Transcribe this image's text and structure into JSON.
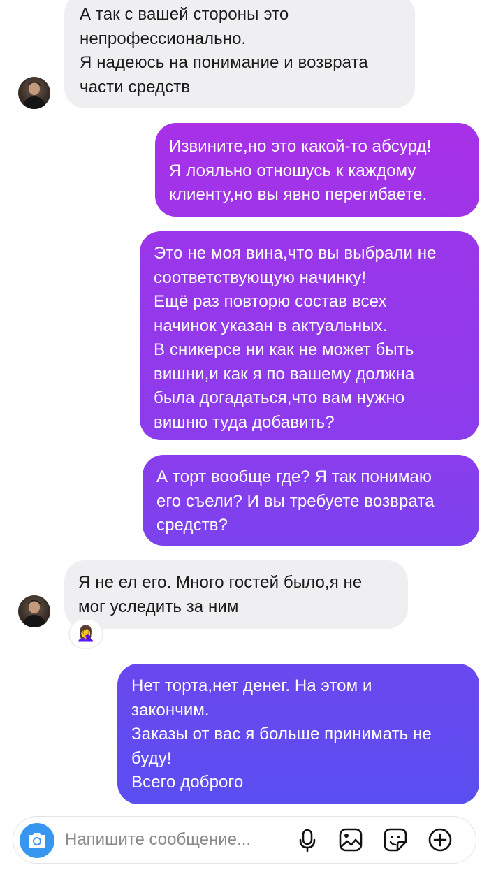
{
  "messages": [
    {
      "side": "incoming",
      "lines": [
        "А так с вашей стороны это",
        "непрофессионально.",
        "Я надеюсь на понимание и возврата",
        "части средств"
      ]
    },
    {
      "side": "outgoing",
      "lines": [
        "Извините,но это какой-то абсурд!",
        "Я лояльно отношусь к каждому",
        "клиенту,но вы явно перегибаете."
      ]
    },
    {
      "side": "outgoing",
      "lines": [
        "Это не моя вина,что вы выбрали не",
        "соответствующую начинку!",
        "Ещё раз повторю состав всех",
        "начинок указан в актуальных.",
        "В сникерсе ни как не может быть",
        "вишни,и как я по вашему должна",
        "была догадаться,что вам нужно",
        "вишню туда добавить?"
      ]
    },
    {
      "side": "outgoing",
      "lines": [
        "А торт вообще где? Я так понимаю",
        "его съели? И вы требуете возврата",
        "средств?"
      ]
    },
    {
      "side": "incoming",
      "lines": [
        "Я не ел его. Много гостей было,я не",
        "мог уследить за ним"
      ],
      "reaction": "🤦‍♀️"
    },
    {
      "side": "outgoing",
      "lines": [
        "Нет торта,нет денег. На этом и",
        "закончим.",
        "Заказы от вас я больше принимать не",
        "буду!",
        "Всего доброго"
      ]
    }
  ],
  "composer": {
    "placeholder": "Напишите сообщение..."
  },
  "icons": {
    "camera": "camera-icon",
    "mic": "microphone-icon",
    "gallery": "gallery-icon",
    "sticker": "sticker-icon",
    "more": "plus-icon"
  },
  "colors": {
    "incoming_bubble": "#efeff1",
    "outgoing_top": "#a233e8",
    "outgoing_bottom": "#5a4df0",
    "camera_button": "#3797f0"
  }
}
